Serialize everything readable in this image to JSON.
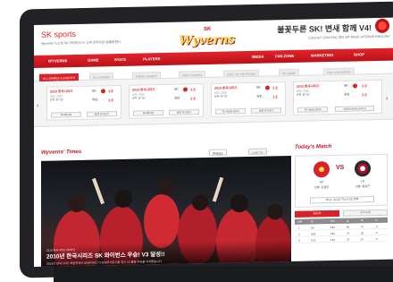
{
  "header": {
    "logo_main": "SK",
    "logo_sub": "sports",
    "slogan": "불꽃두른 SK! 변새 함께 V4!",
    "utility_left": "Wyverns  뉴스센  SK 와이번스TV  고객 온라인샵  팬클럽센터",
    "utility_right": "LOGOUT  JOIN  FAQ  정보  MY PAGE  SITEMAP  ENGLISH"
  },
  "brand": {
    "prefix": "SK",
    "word": "Wyverns"
  },
  "nav": {
    "items": [
      "WYVERNS",
      "GAME",
      "STATS",
      "PLAYERS",
      "MEDIA",
      "FAN ZONE",
      "MARKETING",
      "SHOP"
    ]
  },
  "scores": {
    "tabs": [
      "ALL GAMES & EVENTS",
      "ALL GAMES",
      "EVENT GAMES",
      "FIRST GAMES",
      "ONLY IN THE ROOM",
      "SK GAME",
      "FULL CALENDAR"
    ],
    "cards": [
      {
        "title": "2010 한국시리즈",
        "sub": "SEP. 2010",
        "venue": "문학 경기장",
        "home": "SK",
        "away": "국인",
        "home_score": "1:2",
        "away_score": "1:2",
        "btn1": "하이라이트",
        "btn2": "응원 다시보기"
      },
      {
        "title": "2010 한국시리즈",
        "sub": "SEP. 2010",
        "venue": "문학 경기장",
        "home": "SK",
        "away": "국인",
        "home_score": "1:2",
        "away_score": "1:2",
        "btn1": "하이라이트",
        "btn2": "응원 다시보기"
      },
      {
        "title": "2010 한국시리즈",
        "sub": "SEP. 2010",
        "venue": "문학 경기장",
        "home": "SK",
        "away": "국인",
        "home_score": "1:2",
        "away_score": "1:2",
        "btn1": "TO VIEW DATA",
        "btn2": "응원 다시보기"
      },
      {
        "title": "2010 한국시리즈",
        "sub": "SEP. 2010",
        "venue": "문학 경기장",
        "home": "SK",
        "away": "국인",
        "home_score": "1:2",
        "away_score": "1:2",
        "btn1": "TO VIEW DATA",
        "btn2": "VIEW HIGHLIGHTS"
      }
    ]
  },
  "times": {
    "title": "Wyverns' Times",
    "press_tab": "PRESS",
    "live_tab": "LIVE TV",
    "kicker": "2010 한국시리즈 제4차전",
    "headline": "2010년 한국시리즈 SK 와이번스 우승! V3 달성!!",
    "subline": "2010년 한국시리즈 최종전에서 SK와이번스가 삼성라이온즈를 꺾고 V3 통합 우승을 차지했습니다"
  },
  "match": {
    "title": "Today's Match",
    "vs": "VS",
    "home_name": "SK",
    "home_info": "선발: 김광현",
    "away_name": "LG",
    "away_info": "선발: 봉중근",
    "time": "2011. 04.02  Thu 2:00 문학"
  },
  "ranking": {
    "tab_on": "팀순위",
    "tab_off": "선수순위",
    "head": [
      "순위",
      "팀",
      "경기",
      "승",
      "패",
      "무"
    ],
    "rows": [
      [
        "1",
        "SK",
        "133",
        "84",
        "47",
        "2"
      ],
      [
        "2",
        "삼성",
        "133",
        "79",
        "52",
        "2"
      ],
      [
        "3",
        "두산",
        "133",
        "73",
        "57",
        "3"
      ]
    ]
  }
}
